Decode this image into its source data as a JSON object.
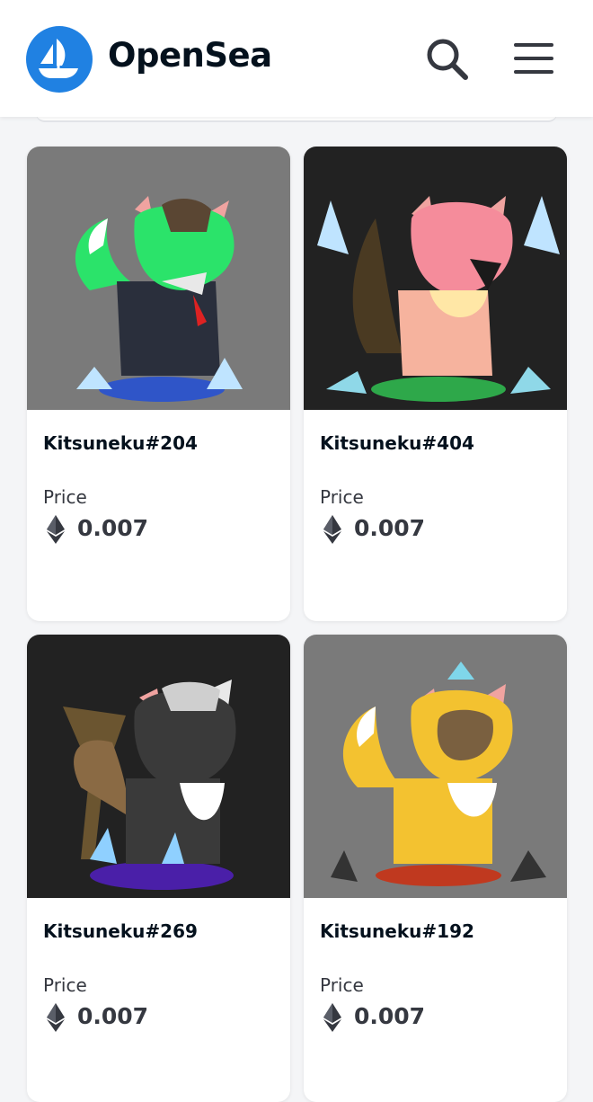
{
  "header": {
    "brand": "OpenSea",
    "logo_icon": "opensea-boat-icon",
    "search_icon": "search-icon",
    "menu_icon": "hamburger-menu-icon",
    "brand_color": "#2081e2"
  },
  "items": [
    {
      "name": "Kitsuneku#204",
      "price_label": "Price",
      "price": "0.007",
      "currency_icon": "ethereum-icon",
      "background": "#7a7a7a"
    },
    {
      "name": "Kitsuneku#404",
      "price_label": "Price",
      "price": "0.007",
      "currency_icon": "ethereum-icon",
      "background": "#222222"
    },
    {
      "name": "Kitsuneku#269",
      "price_label": "Price",
      "price": "0.007",
      "currency_icon": "ethereum-icon",
      "background": "#222222"
    },
    {
      "name": "Kitsuneku#192",
      "price_label": "Price",
      "price": "0.007",
      "currency_icon": "ethereum-icon",
      "background": "#7a7a7a"
    }
  ]
}
